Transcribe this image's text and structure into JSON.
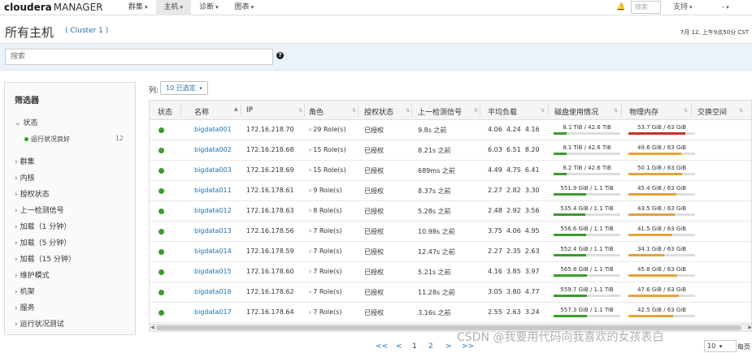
{
  "app": {
    "logo_brand": "cloudera",
    "logo_product": "MANAGER"
  },
  "nav": {
    "items": [
      {
        "label": "群集",
        "active": false
      },
      {
        "label": "主机",
        "active": true
      },
      {
        "label": "诊断",
        "active": false
      },
      {
        "label": "图表",
        "active": false
      }
    ],
    "search_placeholder": "搜索",
    "support_label": "支持",
    "user_label": "-"
  },
  "header": {
    "title": "所有主机",
    "cluster_link": "( Cluster 1 )",
    "datetime": "7月 12, 上午9点50分 CST"
  },
  "search": {
    "placeholder": "搜索",
    "help": "?"
  },
  "filters": {
    "title": "筛选器",
    "status_label": "状态",
    "status_sub_label": "运行状况良好",
    "status_sub_count": "12",
    "groups": [
      "群集",
      "内核",
      "授权状态",
      "上一检测信号",
      "加载（1 分钟）",
      "加载（5 分钟）",
      "加载（15 分钟）",
      "维护模式",
      "机架",
      "服务",
      "运行状况测试"
    ]
  },
  "columns_control": {
    "label": "列:",
    "button": "10 已选定"
  },
  "table": {
    "headers": [
      "状态",
      "名称",
      "IP",
      "角色",
      "授权状态",
      "上一检测信号",
      "平均负载",
      "磁盘使用情况",
      "物理内存",
      "交换空间"
    ],
    "rows": [
      {
        "name": "bigdata001",
        "ip": "172.16.218.70",
        "roles": "29 Role(s)",
        "auth": "已授权",
        "heartbeat": "9.8s 之前",
        "load": "4.06  4.24  4.16",
        "disk": "8.1 TiB / 42.6 TiB",
        "disk_frac": 0.19,
        "mem": "53.7 GiB / 63 GiB",
        "mem_frac": 0.85,
        "mem_color": "#c9302c"
      },
      {
        "name": "bigdata002",
        "ip": "172.16.218.68",
        "roles": "15 Role(s)",
        "auth": "已授权",
        "heartbeat": "8.21s 之前",
        "load": "6.03  6.51  8.20",
        "disk": "8.1 TiB / 42.6 TiB",
        "disk_frac": 0.19,
        "mem": "49.6 GiB / 63 GiB",
        "mem_frac": 0.79,
        "mem_color": "#e6a23c"
      },
      {
        "name": "bigdata003",
        "ip": "172.16.218.69",
        "roles": "15 Role(s)",
        "auth": "已授权",
        "heartbeat": "689ms 之前",
        "load": "4.49  4.75  6.41",
        "disk": "8.2 TiB / 42.6 TiB",
        "disk_frac": 0.19,
        "mem": "50.1 GiB / 63 GiB",
        "mem_frac": 0.8,
        "mem_color": "#e6a23c"
      },
      {
        "name": "bigdata011",
        "ip": "172.16.178.61",
        "roles": "9 Role(s)",
        "auth": "已授权",
        "heartbeat": "8.37s 之前",
        "load": "2.27  2.82  3.30",
        "disk": "551.9 GiB / 1.1 TiB",
        "disk_frac": 0.49,
        "mem": "45.4 GiB / 63 GiB",
        "mem_frac": 0.72,
        "mem_color": "#e6a23c"
      },
      {
        "name": "bigdata012",
        "ip": "172.16.178.63",
        "roles": "8 Role(s)",
        "auth": "已授权",
        "heartbeat": "5.28s 之前",
        "load": "2.48  2.92  3.56",
        "disk": "535.4 GiB / 1.1 TiB",
        "disk_frac": 0.48,
        "mem": "43.5 GiB / 63 GiB",
        "mem_frac": 0.69,
        "mem_color": "#e6a23c"
      },
      {
        "name": "bigdata013",
        "ip": "172.16.178.56",
        "roles": "7 Role(s)",
        "auth": "已授权",
        "heartbeat": "10.98s 之前",
        "load": "3.75  4.06  4.95",
        "disk": "556.6 GiB / 1.1 TiB",
        "disk_frac": 0.49,
        "mem": "41.5 GiB / 63 GiB",
        "mem_frac": 0.66,
        "mem_color": "#e6a23c"
      },
      {
        "name": "bigdata014",
        "ip": "172.16.178.59",
        "roles": "7 Role(s)",
        "auth": "已授权",
        "heartbeat": "12.47s 之前",
        "load": "2.27  2.35  2.63",
        "disk": "552.4 GiB / 1.1 TiB",
        "disk_frac": 0.49,
        "mem": "34.1 GiB / 63 GiB",
        "mem_frac": 0.54,
        "mem_color": "#e6a23c"
      },
      {
        "name": "bigdata015",
        "ip": "172.16.178.60",
        "roles": "7 Role(s)",
        "auth": "已授权",
        "heartbeat": "5.21s 之前",
        "load": "4.16  3.85  3.97",
        "disk": "565.8 GiB / 1.1 TiB",
        "disk_frac": 0.5,
        "mem": "45.8 GiB / 63 GiB",
        "mem_frac": 0.73,
        "mem_color": "#e6a23c"
      },
      {
        "name": "bigdata016",
        "ip": "172.16.178.62",
        "roles": "7 Role(s)",
        "auth": "已授权",
        "heartbeat": "11.28s 之前",
        "load": "3.05  3.80  4.77",
        "disk": "559.7 GiB / 1.1 TiB",
        "disk_frac": 0.5,
        "mem": "47.6 GiB / 63 GiB",
        "mem_frac": 0.76,
        "mem_color": "#e6a23c"
      },
      {
        "name": "bigdata017",
        "ip": "172.16.178.64",
        "roles": "7 Role(s)",
        "auth": "已授权",
        "heartbeat": "3.16s 之前",
        "load": "2.55  2.63  3.24",
        "disk": "557.3 GiB / 1.1 TiB",
        "disk_frac": 0.5,
        "mem": "42.5 GiB / 63 GiB",
        "mem_frac": 0.67,
        "mem_color": "#e6a23c"
      }
    ]
  },
  "pagination": {
    "first": "<<",
    "prev": "<",
    "pages": [
      "1",
      "2"
    ],
    "next": ">",
    "last": ">>",
    "per_page": "10",
    "per_page_label": "每页"
  },
  "colors": {
    "accent": "#1f6fb2",
    "ok": "#3c9a2e",
    "disk_bar": "#3c9a2e"
  },
  "watermark": "CSDN @我要用代码向我喜欢的女孩表白"
}
